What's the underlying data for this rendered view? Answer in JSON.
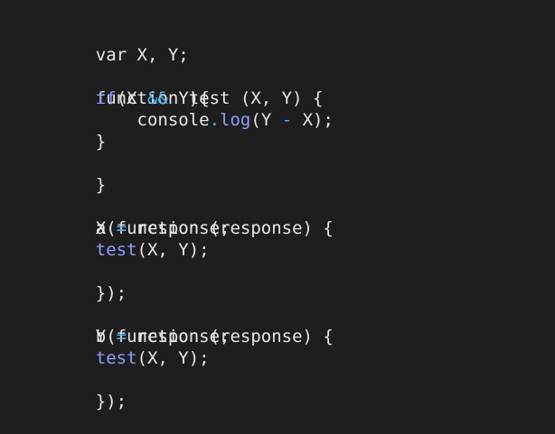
{
  "code": {
    "line1": "var X, Y;",
    "line3": "function test (X, Y) {",
    "line4": {
      "kw_if": "if",
      "t1": "(X ",
      "op_and": "&&",
      "t2": " Y){"
    },
    "line5": {
      "t1": "console",
      "dot": ".",
      "method": "log",
      "t2": "(Y ",
      "op_minus": "-",
      "t3": " X);"
    },
    "line6": "}",
    "line7": "}",
    "line9": "a(function (response) {",
    "line10": {
      "t1": "X ",
      "op_eq": "=",
      "t2": " response;"
    },
    "line11": {
      "call": "test",
      "t1": "(X, Y);"
    },
    "line12": "});",
    "line14": "b(function (response) {",
    "line15": {
      "t1": "Y ",
      "op_eq": "=",
      "t2": " response;"
    },
    "line16": {
      "call": "test",
      "t1": "(X, Y);"
    },
    "line17": "});"
  },
  "colors": {
    "background": "#1e1e1e",
    "text": "#e6e6e6",
    "keyword": "#8f9dff",
    "operator": "#4fb4f2"
  }
}
